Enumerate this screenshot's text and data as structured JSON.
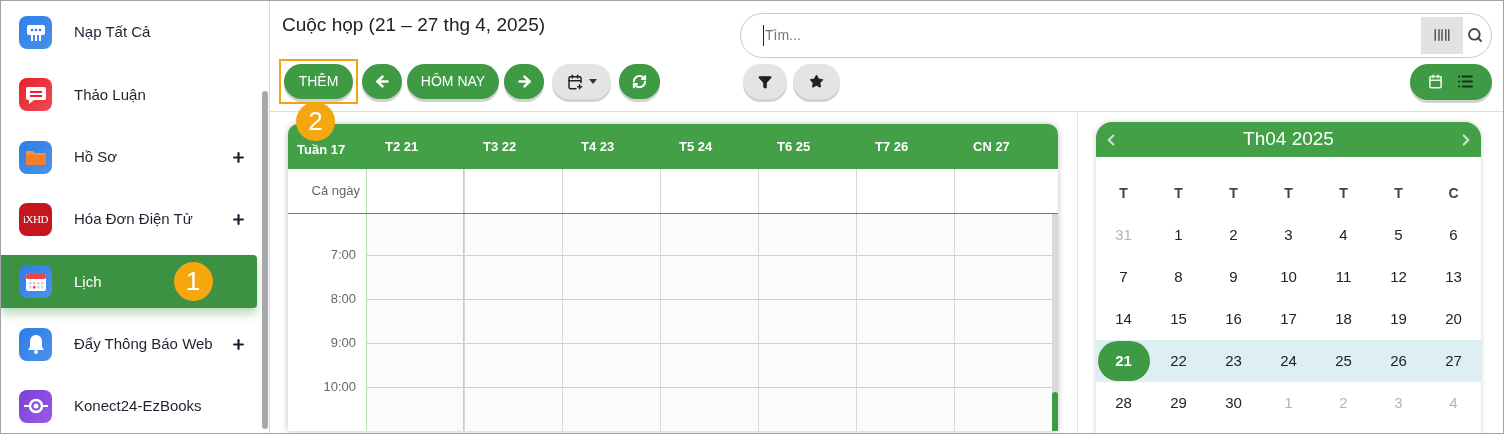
{
  "sidebar": {
    "items": [
      {
        "label": "Nạp Tất Cả",
        "expandable": false,
        "selected": false
      },
      {
        "label": "Thảo Luận",
        "expandable": false,
        "selected": false
      },
      {
        "label": "Hồ Sơ",
        "expandable": true,
        "selected": false
      },
      {
        "label": "Hóa Đơn Điện Tử",
        "expandable": true,
        "selected": false,
        "icon_text": "iXHD"
      },
      {
        "label": "Lịch",
        "expandable": false,
        "selected": true,
        "badge": "1"
      },
      {
        "label": "Đẩy Thông Báo Web",
        "expandable": true,
        "selected": false
      },
      {
        "label": "Konect24-EzBooks",
        "expandable": false,
        "selected": false
      }
    ]
  },
  "title": "Cuộc họp (21 – 27 thg 4, 2025)",
  "toolbar": {
    "add_button": {
      "label": "THÊM",
      "highlighted": true,
      "callout": "2"
    },
    "today_button": "HÔM NAY",
    "view_options": [
      {
        "kind": "calendar",
        "selected": true
      },
      {
        "kind": "list",
        "selected": false
      }
    ]
  },
  "search": {
    "placeholder": "Tìm..."
  },
  "week_view": {
    "corner": "Tuần 17",
    "all_day_label": "Cả ngày",
    "days": [
      {
        "label": "T2 21",
        "selected": true
      },
      {
        "label": "T3 22",
        "selected": false
      },
      {
        "label": "T4 23",
        "selected": false
      },
      {
        "label": "T5 24",
        "selected": false
      },
      {
        "label": "T6 25",
        "selected": false
      },
      {
        "label": "T7 26",
        "selected": false
      },
      {
        "label": "CN 27",
        "selected": false
      }
    ],
    "hours": [
      "7:00",
      "8:00",
      "9:00",
      "10:00"
    ]
  },
  "mini_calendar": {
    "title": "Th04 2025",
    "weekdays": [
      "T",
      "T",
      "T",
      "T",
      "T",
      "T",
      "C"
    ],
    "weeks": [
      {
        "current": false,
        "days": [
          {
            "label": "31",
            "outside": true,
            "selected": false
          },
          {
            "label": "1",
            "outside": false,
            "selected": false
          },
          {
            "label": "2",
            "outside": false,
            "selected": false
          },
          {
            "label": "3",
            "outside": false,
            "selected": false
          },
          {
            "label": "4",
            "outside": false,
            "selected": false
          },
          {
            "label": "5",
            "outside": false,
            "selected": false
          },
          {
            "label": "6",
            "outside": false,
            "selected": false
          }
        ]
      },
      {
        "current": false,
        "days": [
          {
            "label": "7",
            "outside": false,
            "selected": false
          },
          {
            "label": "8",
            "outside": false,
            "selected": false
          },
          {
            "label": "9",
            "outside": false,
            "selected": false
          },
          {
            "label": "10",
            "outside": false,
            "selected": false
          },
          {
            "label": "11",
            "outside": false,
            "selected": false
          },
          {
            "label": "12",
            "outside": false,
            "selected": false
          },
          {
            "label": "13",
            "outside": false,
            "selected": false
          }
        ]
      },
      {
        "current": false,
        "days": [
          {
            "label": "14",
            "outside": false,
            "selected": false
          },
          {
            "label": "15",
            "outside": false,
            "selected": false
          },
          {
            "label": "16",
            "outside": false,
            "selected": false
          },
          {
            "label": "17",
            "outside": false,
            "selected": false
          },
          {
            "label": "18",
            "outside": false,
            "selected": false
          },
          {
            "label": "19",
            "outside": false,
            "selected": false
          },
          {
            "label": "20",
            "outside": false,
            "selected": false
          }
        ]
      },
      {
        "current": true,
        "days": [
          {
            "label": "21",
            "outside": false,
            "selected": true
          },
          {
            "label": "22",
            "outside": false,
            "selected": false
          },
          {
            "label": "23",
            "outside": false,
            "selected": false
          },
          {
            "label": "24",
            "outside": false,
            "selected": false
          },
          {
            "label": "25",
            "outside": false,
            "selected": false
          },
          {
            "label": "26",
            "outside": false,
            "selected": false
          },
          {
            "label": "27",
            "outside": false,
            "selected": false
          }
        ]
      },
      {
        "current": false,
        "days": [
          {
            "label": "28",
            "outside": false,
            "selected": false
          },
          {
            "label": "29",
            "outside": false,
            "selected": false
          },
          {
            "label": "30",
            "outside": false,
            "selected": false
          },
          {
            "label": "1",
            "outside": true,
            "selected": false
          },
          {
            "label": "2",
            "outside": true,
            "selected": false
          },
          {
            "label": "3",
            "outside": true,
            "selected": false
          },
          {
            "label": "4",
            "outside": true,
            "selected": false
          }
        ]
      }
    ]
  }
}
